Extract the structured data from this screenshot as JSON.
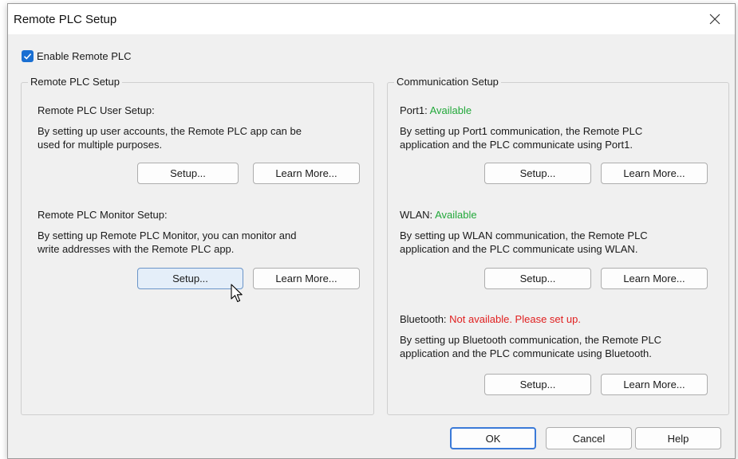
{
  "window": {
    "title": "Remote PLC Setup"
  },
  "enable": {
    "label": "Enable Remote PLC",
    "checked": true
  },
  "left_group": {
    "legend": "Remote PLC Setup",
    "user_setup": {
      "heading": "Remote PLC User Setup:",
      "desc_line1": "By setting up user accounts, the Remote PLC app can be",
      "desc_line2": "used for multiple purposes.",
      "setup_label": "Setup...",
      "learn_label": "Learn More..."
    },
    "monitor_setup": {
      "heading": "Remote PLC Monitor Setup:",
      "desc_line1": "By setting up Remote PLC Monitor, you can monitor and",
      "desc_line2": "write addresses with the Remote PLC app.",
      "setup_label": "Setup...",
      "learn_label": "Learn More..."
    }
  },
  "right_group": {
    "legend": "Communication Setup",
    "port1": {
      "label": "Port1:",
      "status": "Available",
      "desc_line1": "By setting up Port1 communication, the Remote PLC",
      "desc_line2": "application and the PLC communicate using Port1.",
      "setup_label": "Setup...",
      "learn_label": "Learn More..."
    },
    "wlan": {
      "label": "WLAN:",
      "status": "Available",
      "desc_line1": "By setting up WLAN communication, the Remote PLC",
      "desc_line2": "application and the PLC communicate using WLAN.",
      "setup_label": "Setup...",
      "learn_label": "Learn More..."
    },
    "bluetooth": {
      "label": "Bluetooth:",
      "status": "Not available. Please set up.",
      "desc_line1": "By setting up Bluetooth communication, the Remote PLC",
      "desc_line2": "application and the PLC communicate using Bluetooth.",
      "setup_label": "Setup...",
      "learn_label": "Learn More..."
    }
  },
  "footer": {
    "ok_label": "OK",
    "cancel_label": "Cancel",
    "help_label": "Help"
  },
  "colors": {
    "available": "#22a83a",
    "not_available": "#e02020",
    "accent": "#1a6fd2"
  },
  "icons": {
    "close": "close-icon",
    "check": "checkmark-icon",
    "cursor": "mouse-pointer-icon"
  }
}
